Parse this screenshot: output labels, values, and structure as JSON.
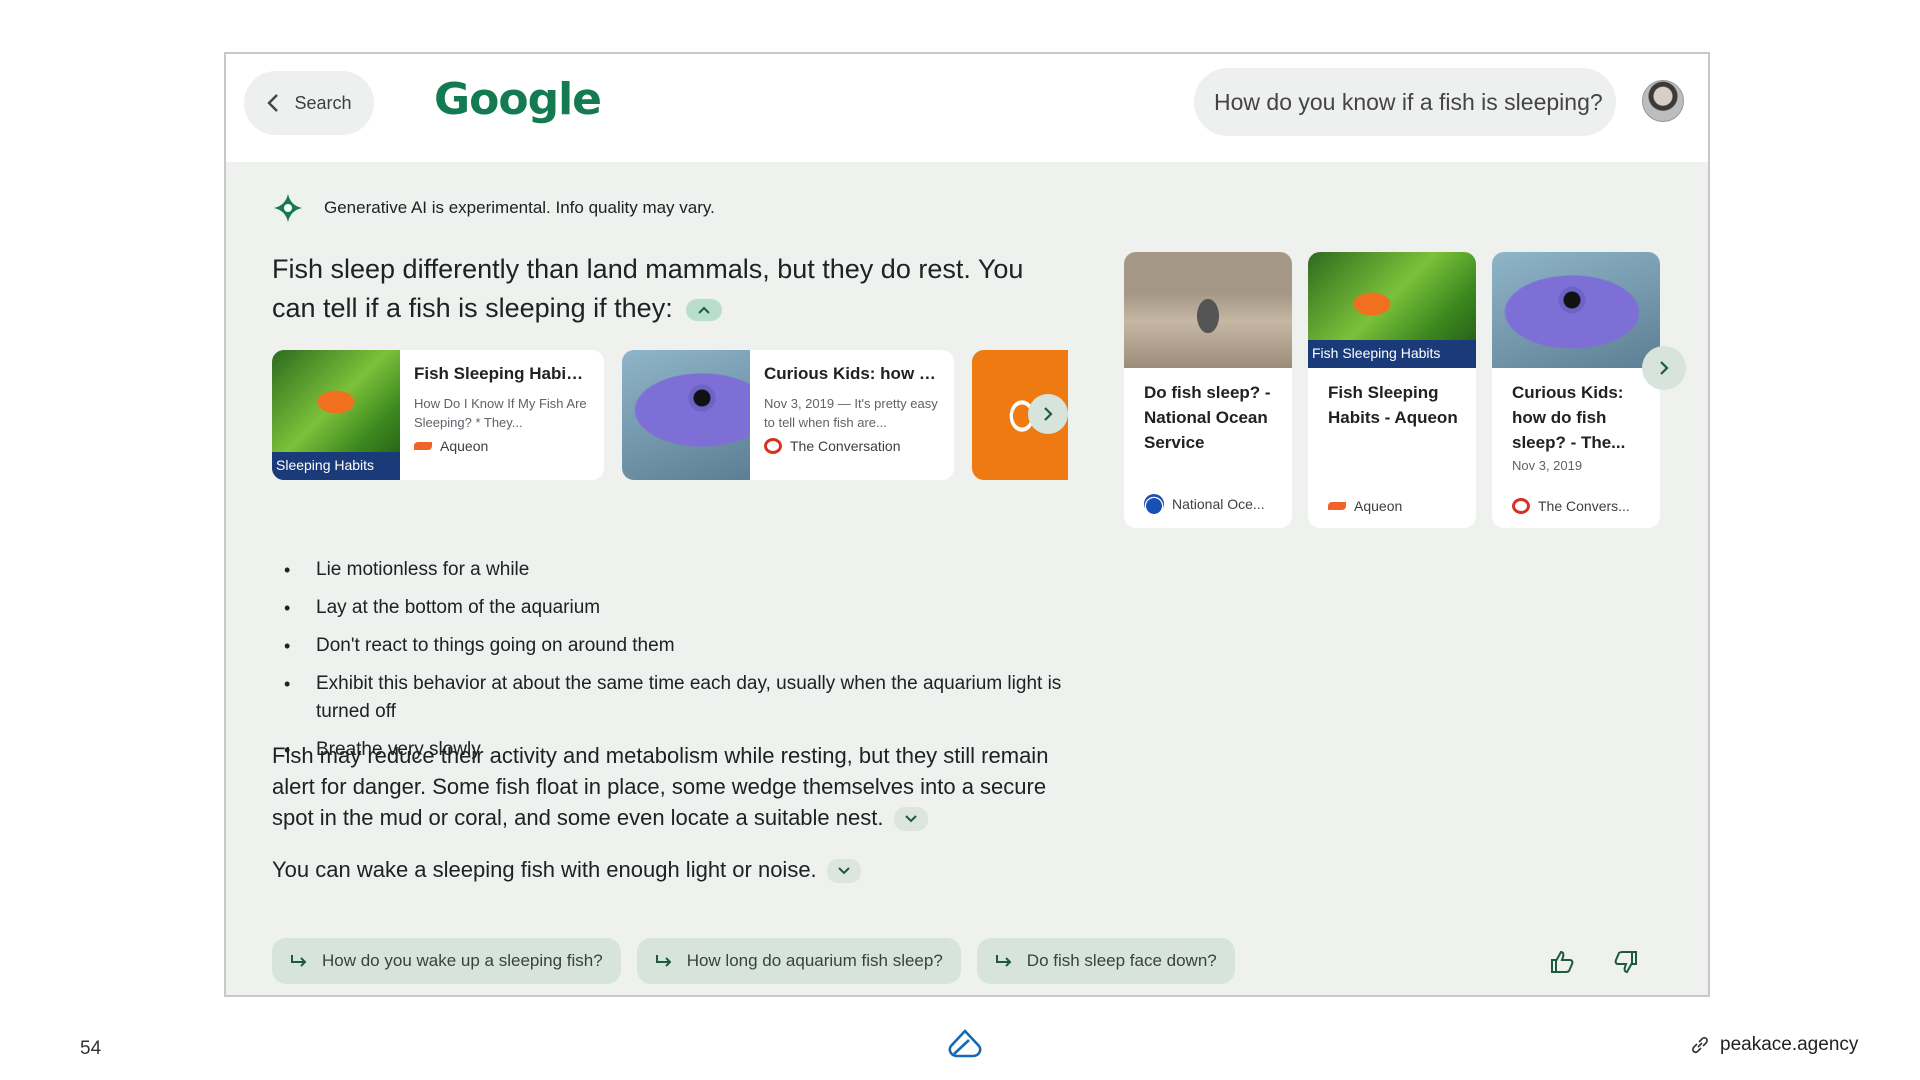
{
  "header": {
    "back_label": "Search",
    "logo_text": "Google",
    "query": "How do you know if a fish is sleeping?"
  },
  "notice": "Generative AI is experimental. Info quality may vary.",
  "answer": {
    "headline": "Fish sleep differently than land mammals, but they do rest. You can tell if a fish is sleeping if they:",
    "bullets": [
      "Lie motionless for a while",
      "Lay at the bottom of the aquarium",
      "Don't react to things going on around them",
      "Exhibit this behavior at about the same time each day, usually when the aquarium light is turned off",
      "Breathe very slowly"
    ],
    "para1": "Fish may reduce their activity and metabolism while resting, but they still remain alert for danger. Some fish float in place, some wedge themselves into a secure spot in the mud or coral, and some even locate a suitable nest.",
    "para2": "You can wake a sleeping fish with enough light or noise."
  },
  "inline_sources": [
    {
      "thumb_label": "Sleeping Habits",
      "title": "Fish Sleeping Habits ...",
      "snippet": "How Do I Know If My Fish Are Sleeping? * They...",
      "site": "Aqueon"
    },
    {
      "thumb_label": "",
      "title": "Curious Kids: how do...",
      "snippet": "Nov 3, 2019 — It's pretty easy to tell when fish are...",
      "site": "The Conversation"
    }
  ],
  "side_sources": [
    {
      "thumb_label": "",
      "title": "Do fish sleep? - National Ocean Service",
      "date": "",
      "site": "National Oce..."
    },
    {
      "thumb_label": "Fish Sleeping Habits",
      "title": "Fish Sleeping Habits - Aqueon",
      "date": "",
      "site": "Aqueon"
    },
    {
      "thumb_label": "",
      "title": "Curious Kids: how do fish sleep? - The...",
      "date": "Nov 3, 2019",
      "site": "The Convers..."
    }
  ],
  "followups": [
    "How do you wake up a sleeping fish?",
    "How long do aquarium fish sleep?",
    "Do fish sleep face down?"
  ],
  "footer": {
    "page_number": "54",
    "site": "peakace.agency"
  },
  "colors": {
    "accent_green": "#137a51",
    "panel_bg": "#eef1ee",
    "chip_bg": "#d6e4dc"
  }
}
